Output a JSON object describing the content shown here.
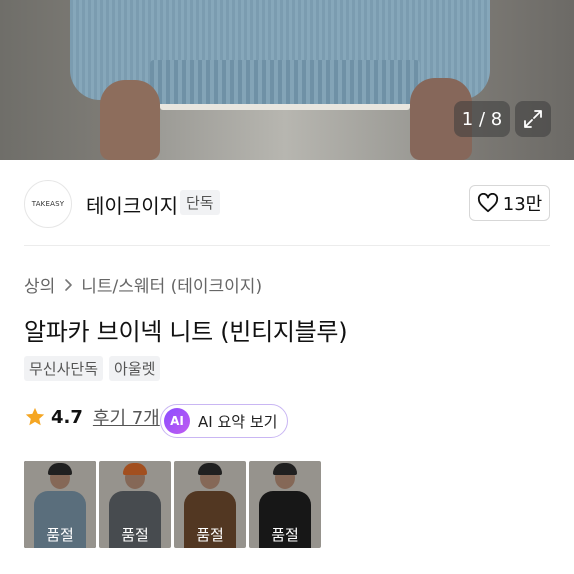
{
  "gallery": {
    "counter": "1 / 8",
    "expand_icon": "expand-icon"
  },
  "brand": {
    "logo_text": "TAKEASY",
    "name": "테이크이지",
    "badge": "단독",
    "like_count": "13만",
    "like_icon": "heart-outline-icon"
  },
  "breadcrumb": {
    "items": [
      "상의",
      "니트/스웨터 (테이크이지)"
    ],
    "separator_icon": "chevron-right-icon"
  },
  "product": {
    "title": "알파카 브이넥 니트 (빈티지블루)",
    "tags": [
      "무신사단독",
      "아울렛"
    ]
  },
  "rating": {
    "star_icon": "star-icon",
    "score": "4.7",
    "review_link": "후기 7개",
    "ai_badge": "AI",
    "ai_summary": "AI 요약 보기"
  },
  "colors": {
    "star": "#f5a623",
    "ai_gradient_start": "#8a4dff",
    "ai_gradient_end": "#c05cf0"
  },
  "thumbnails": [
    {
      "label": "품절",
      "sweater_color": "#7893a6",
      "hat_color": "#2b2b2b",
      "selected": true
    },
    {
      "label": "품절",
      "sweater_color": "#5f646a",
      "hat_color": "#d86a2a",
      "selected": false
    },
    {
      "label": "품절",
      "sweater_color": "#6e4a2e",
      "hat_color": "#2b2b2b",
      "selected": false
    },
    {
      "label": "품절",
      "sweater_color": "#1f1f1f",
      "hat_color": "#2b2b2b",
      "selected": false
    }
  ]
}
